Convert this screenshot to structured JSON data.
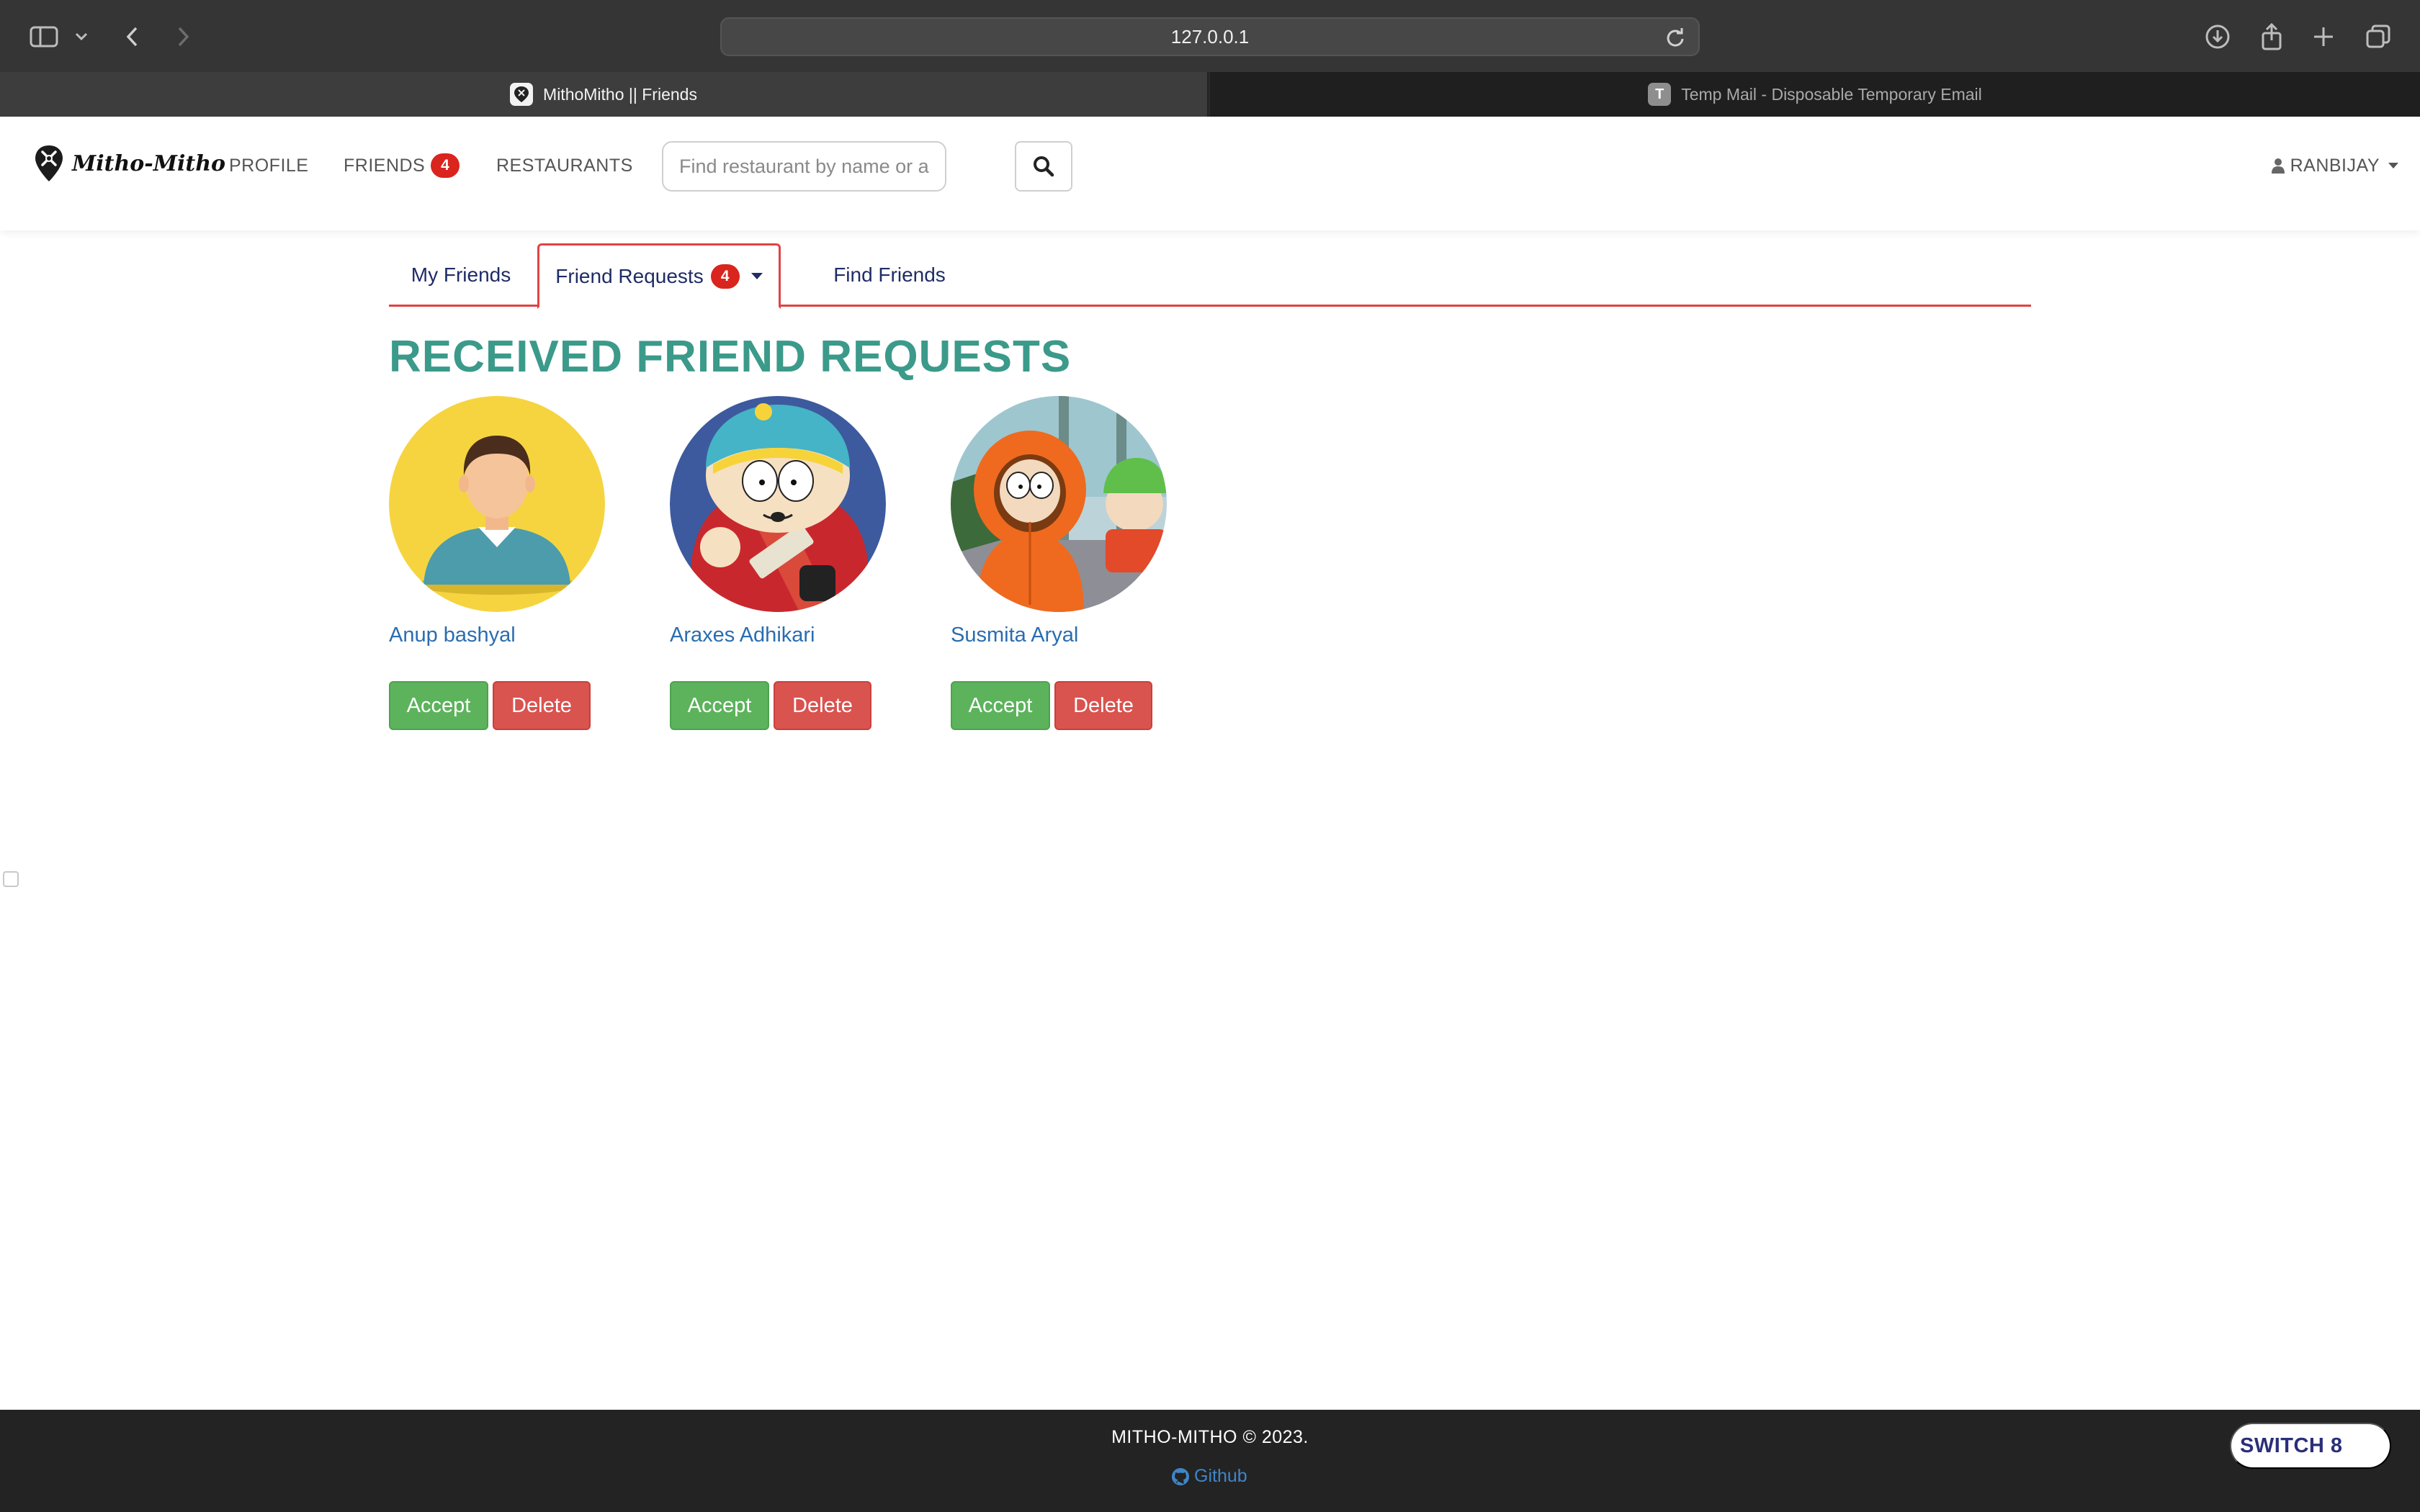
{
  "browser": {
    "url": "127.0.0.1",
    "tabs": [
      {
        "title": "MithoMitho || Friends",
        "active": true
      },
      {
        "title": "Temp Mail - Disposable Temporary Email",
        "favicon_letter": "T",
        "active": false
      }
    ]
  },
  "navbar": {
    "brand": "Mitho-Mitho",
    "links": {
      "profile": "PROFILE",
      "friends": "FRIENDS",
      "friends_badge": "4",
      "restaurants": "RESTAURANTS"
    },
    "search": {
      "placeholder": "Find restaurant by name or address",
      "value": ""
    },
    "user": "RANBIJAY"
  },
  "friends_tabs": {
    "my_friends": "My Friends",
    "friend_requests": "Friend Requests",
    "friend_requests_badge": "4",
    "find_friends": "Find Friends"
  },
  "section_title": "RECEIVED FRIEND REQUESTS",
  "requests": [
    {
      "name": "Anup bashyal",
      "avatar": "default-avatar-icon",
      "accept": "Accept",
      "delete": "Delete"
    },
    {
      "name": "Araxes Adhikari",
      "avatar": "cartman-avatar",
      "accept": "Accept",
      "delete": "Delete"
    },
    {
      "name": "Susmita Aryal",
      "avatar": "kenny-avatar",
      "accept": "Accept",
      "delete": "Delete"
    }
  ],
  "footer": {
    "copyright": "MITHO-MITHO © 2023.",
    "github": "Github",
    "switch_button": "SWITCH 8"
  },
  "colors": {
    "accent_red": "#d9251d",
    "title_teal": "#3b9a8a",
    "accept_green": "#5cb35c",
    "delete_red": "#d9534f",
    "link_blue": "#2a6db0"
  }
}
